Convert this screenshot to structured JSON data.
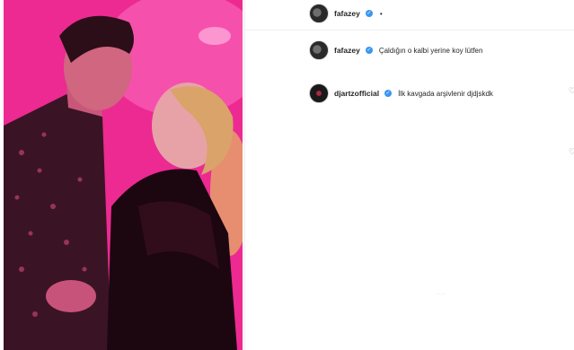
{
  "post": {
    "author": "fafazey",
    "header_separator": "•",
    "verified_mark": "✓"
  },
  "comments": [
    {
      "username": "fafazey",
      "verified_mark": "✓",
      "text": "Çaldığın o kalbi yerine koy lütfen"
    },
    {
      "username": "djartzofficial",
      "verified_mark": "✓",
      "text": "İlk kavgada arşivlenir djdjskdk"
    }
  ],
  "icons": {
    "like": "heart-icon",
    "avatar": "avatar",
    "badge": "verified-badge-icon"
  },
  "colors": {
    "photo_background": "#f0288f",
    "verified": "#3897f0",
    "text": "#262626",
    "divider": "#efefef"
  },
  "loading_indicator": "...."
}
